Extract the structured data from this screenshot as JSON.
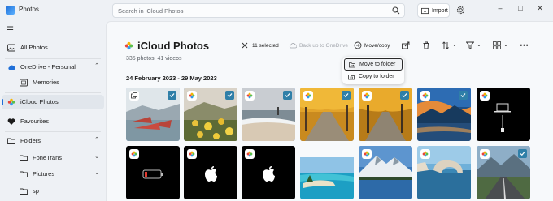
{
  "app": {
    "title": "Photos",
    "window_controls": [
      "minimize",
      "maximize",
      "close"
    ]
  },
  "search": {
    "placeholder": "Search in iCloud Photos"
  },
  "import": {
    "label": "Import"
  },
  "sidebar": {
    "items": [
      {
        "label": "All Photos",
        "icon": "photos-icon"
      },
      {
        "label": "OneDrive - Personal",
        "icon": "cloud-icon",
        "expanded": true
      },
      {
        "label": "Memories",
        "icon": "memories-icon"
      },
      {
        "label": "iCloud Photos",
        "icon": "icloud-photos-icon",
        "active": true
      },
      {
        "label": "Favourites",
        "icon": "heart-icon"
      },
      {
        "label": "Folders",
        "icon": "folder-icon",
        "expanded": true
      },
      {
        "label": "FoneTrans",
        "icon": "folder-icon"
      },
      {
        "label": "Pictures",
        "icon": "folder-icon"
      },
      {
        "label": "sp",
        "icon": "folder-icon"
      }
    ]
  },
  "header": {
    "title": "iCloud Photos",
    "subtitle": "335 photos, 41 videos",
    "date_range": "24 February 2023 - 29 May 2023"
  },
  "toolbar": {
    "selected_label": "11 selected",
    "backup_label": "Back up to OneDrive",
    "move_copy_label": "Move/copy"
  },
  "menu": {
    "items": [
      {
        "label": "Move to folder",
        "highlighted": true
      },
      {
        "label": "Copy to folder",
        "highlighted": false
      }
    ]
  },
  "colors": {
    "accent": "#1f6fd8",
    "check": "#2f7fa8",
    "background": "#eef1f5",
    "pane": "#f7f9fb"
  },
  "photos": [
    {
      "name": "boats-snow",
      "selected": true
    },
    {
      "name": "yellow-flowers",
      "selected": true
    },
    {
      "name": "beach-pier",
      "selected": true
    },
    {
      "name": "autumn-road",
      "selected": true
    },
    {
      "name": "autumn-road-2",
      "selected": true
    },
    {
      "name": "sunset-lake",
      "selected": true
    },
    {
      "name": "charging-black",
      "selected": false
    },
    {
      "name": "low-battery",
      "selected": false
    },
    {
      "name": "apple-logo",
      "selected": false
    },
    {
      "name": "apple-logo-2",
      "selected": false
    },
    {
      "name": "tropical-island",
      "selected": false
    },
    {
      "name": "mountain-lake",
      "selected": false
    },
    {
      "name": "sea-arch",
      "selected": false
    },
    {
      "name": "mountain-road",
      "selected": true
    }
  ]
}
